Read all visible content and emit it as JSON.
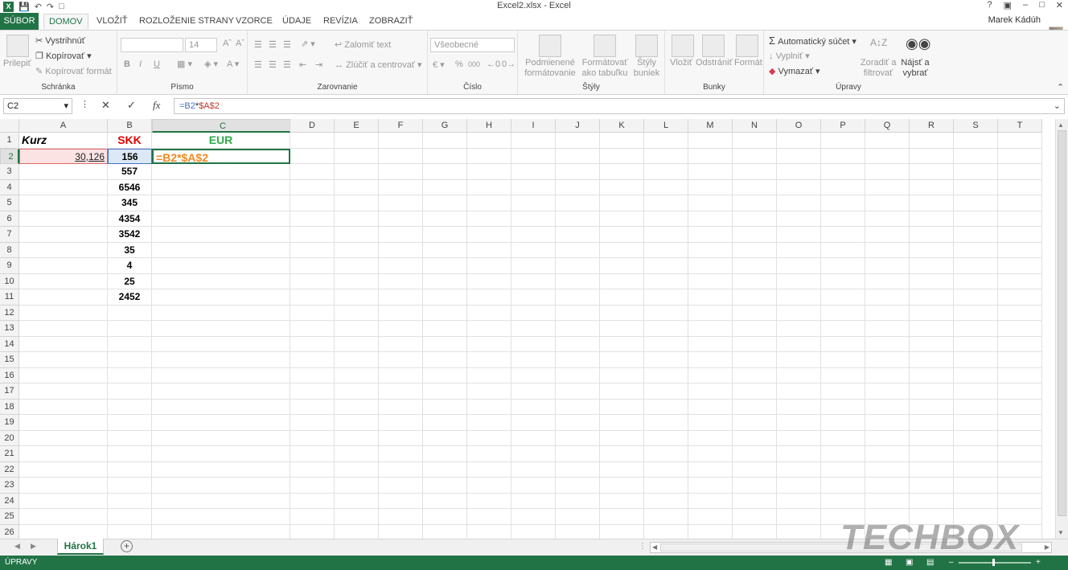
{
  "window": {
    "title": "Excel2.xlsx - Excel",
    "help": "?",
    "user": "Marek Kádúh"
  },
  "tabs": [
    "SÚBOR",
    "DOMOV",
    "VLOŽIŤ",
    "ROZLOŽENIE STRANY",
    "VZORCE",
    "ÚDAJE",
    "REVÍZIA",
    "ZOBRAZIŤ"
  ],
  "ribbon": {
    "clipboard": {
      "paste": "Prilepiť",
      "cut": "Vystrihnúť",
      "copy": "Kopírovať",
      "format_painter": "Kopírovať formát",
      "label": "Schránka"
    },
    "font": {
      "size": "14",
      "bold": "B",
      "italic": "I",
      "underline": "U",
      "label": "Písmo"
    },
    "alignment": {
      "wrap": "Zalomiť text",
      "merge": "Zlúčiť a centrovať",
      "label": "Zarovnanie"
    },
    "number": {
      "format": "Všeobecné",
      "percent": "%",
      "thousands": "000",
      "label": "Číslo"
    },
    "styles": {
      "conditional": [
        "Podmienené",
        "formátovanie"
      ],
      "table": [
        "Formátovať",
        "ako tabuľku"
      ],
      "cell": [
        "Štýly",
        "buniek"
      ],
      "label": "Štýly"
    },
    "cells": {
      "insert": "Vložiť",
      "delete": "Odstrániť",
      "format": "Formát",
      "label": "Bunky"
    },
    "editing": {
      "autosum": "Automatický súčet",
      "fill": "Vyplniť",
      "clear": "Vymazať",
      "sort": [
        "Zoradiť a",
        "filtrovať"
      ],
      "find": [
        "Nájsť a",
        "vybrať"
      ],
      "label": "Úpravy"
    }
  },
  "formula_bar": {
    "name_box": "C2",
    "fx": "fx",
    "formula_ref1": "=B2",
    "formula_op": "*",
    "formula_ref2": "$A$2"
  },
  "columns": [
    "A",
    "B",
    "C",
    "D",
    "E",
    "F",
    "G",
    "H",
    "I",
    "J",
    "K",
    "L",
    "M",
    "N",
    "O",
    "P",
    "Q",
    "R",
    "S",
    "T"
  ],
  "rows": [
    "1",
    "2",
    "3",
    "4",
    "5",
    "6",
    "7",
    "8",
    "9",
    "10",
    "11",
    "12",
    "13",
    "14",
    "15",
    "16",
    "17",
    "18",
    "19",
    "20",
    "21",
    "22",
    "23",
    "24",
    "25",
    "26"
  ],
  "cells": {
    "A1": "Kurz",
    "B1": "SKK",
    "C1": "EUR",
    "A2": "30,126",
    "B2": "156",
    "C2": "=B2*$A$2",
    "B3": "557",
    "B4": "6546",
    "B5": "345",
    "B6": "4354",
    "B7": "3542",
    "B8": "35",
    "B9": "4",
    "B10": "25",
    "B11": "2452"
  },
  "sheet": {
    "name": "Hárok1",
    "add": "+"
  },
  "status": {
    "mode": "ÚPRAVY"
  },
  "watermark": "TECHBOX",
  "colors": {
    "excel_green": "#217346",
    "skk_red": "#e00000",
    "eur_green": "#2eab4a",
    "formula_orange": "#f08a24",
    "ref_blue": "#4472c4"
  }
}
